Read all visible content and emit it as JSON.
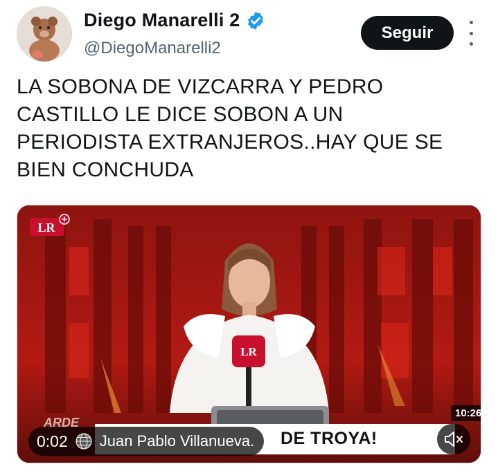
{
  "author": {
    "display_name": "Diego Manarelli 2",
    "handle": "@DiegoManarelli2",
    "verified": true,
    "verified_color": "#1d9bf0"
  },
  "actions": {
    "follow_label": "Seguir",
    "more_icon": "more-vertical-icon"
  },
  "tweet": {
    "text_lines": [
      "LA SOBONA DE VIZCARRA Y PEDRO",
      "CASTILLO LE DICE SOBON A UN",
      "PERIODISTA EXTRANJEROS..HAY QUE SE",
      "BIEN CONCHUDA"
    ]
  },
  "video": {
    "logo_text": "LR",
    "mic_logo_text": "LR",
    "duration_badge": "10:26",
    "elapsed": "0:02",
    "source_label": "Juan Pablo Villanueva.",
    "banner_text": "DE TROYA!",
    "accent_color": "#c8102e"
  }
}
